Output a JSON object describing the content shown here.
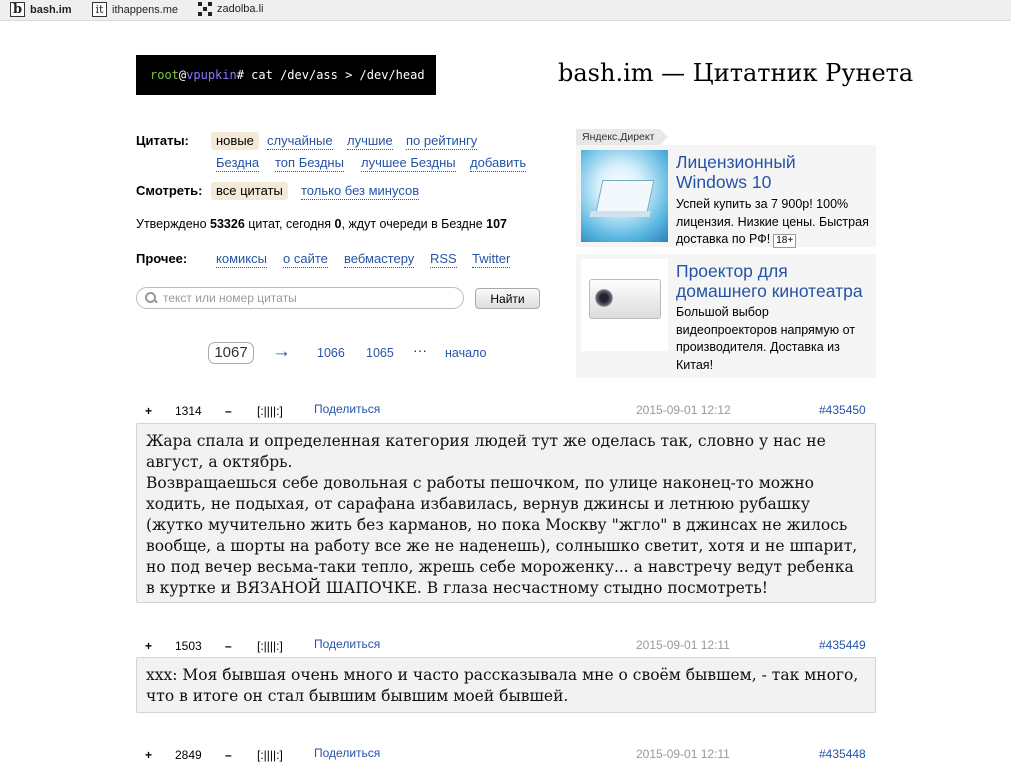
{
  "topbar": {
    "sites": [
      {
        "label": "bash.im",
        "icon": "b"
      },
      {
        "label": "ithappens.me",
        "icon": "it"
      },
      {
        "label": "zadolba.li",
        "icon": "zadolba-icon"
      }
    ]
  },
  "logo": {
    "root": "root",
    "at": "@",
    "host": "vpupkin",
    "cmd": "# cat /dev/ass > /dev/head"
  },
  "site_title": "bash.im — Цитатник Рунета",
  "nav": {
    "quotes_label": "Цитаты:",
    "quotes": [
      "новые",
      "случайные",
      "лучшие",
      "по рейтингу"
    ],
    "quotes_row2": [
      "Бездна",
      "топ Бездны",
      "лучшее Бездны",
      "добавить"
    ],
    "view_label": "Смотреть:",
    "view": [
      "все цитаты",
      "только без минусов"
    ],
    "other_label": "Прочее:",
    "other": [
      "комиксы",
      "о сайте",
      "вебмастеру",
      "RSS",
      "Twitter"
    ]
  },
  "stats": {
    "prefix": "Утверждено ",
    "approved": "53326",
    "mid1": " цитат, сегодня ",
    "today": "0",
    "mid2": ", ждут очереди в Бездне ",
    "queue": "107"
  },
  "search": {
    "placeholder": "текст или номер цитаты",
    "button": "Найти"
  },
  "pager": {
    "current": "1067",
    "arrow": "→",
    "pages": [
      "1066",
      "1065"
    ],
    "dots": "···",
    "start": "начало"
  },
  "ads": {
    "tag": "Яндекс.Директ",
    "items": [
      {
        "title_line1": "Лицензионный",
        "title_line2": "Windows 10",
        "text": "Успей купить за 7 900р! 100% лицензия. Низкие цены. Быстрая доставка по РФ!",
        "age": "18+"
      },
      {
        "title_line1": "Проектор для",
        "title_line2": "домашнего кинотеатра",
        "text": "Большой выбор видеопроекторов напрямую от производителя. Доставка из Китая!"
      }
    ]
  },
  "quotes": [
    {
      "plus": "+",
      "rating": "1314",
      "minus": "–",
      "bayan": "[:||||:]",
      "share": "Поделиться",
      "date": "2015-09-01 12:12",
      "id": "#435450",
      "lines": [
        "Жара спала и определенная категория людей тут же оделась так, словно у нас не август, а октябрь.",
        "Возвращаешься себе довольная с работы пешочком, по улице наконец-то можно ходить, не подыхая, от сарафана избавилась, вернув джинсы и летнюю рубашку (жутко мучительно жить без карманов, но пока Москву \"жгло\" в джинсах не жилось вообще, а шорты на работу все же не наденешь), солнышко светит, хотя и не шпарит, но под вечер весьма-таки тепло, жрешь себе мороженку... а навстречу ведут ребенка в куртке и ВЯЗАНОЙ ШАПОЧКЕ. В глаза несчастному стыдно посмотреть!"
      ]
    },
    {
      "plus": "+",
      "rating": "1503",
      "minus": "–",
      "bayan": "[:||||:]",
      "share": "Поделиться",
      "date": "2015-09-01 12:11",
      "id": "#435449",
      "lines": [
        "xxx: Моя бывшая очень много и часто рассказывала мне о своём бывшем, - так много, что в итоге он стал бывшим бывшим моей бывшей."
      ]
    },
    {
      "plus": "+",
      "rating": "2849",
      "minus": "–",
      "bayan": "[:||||:]",
      "share": "Поделиться",
      "date": "2015-09-01 12:11",
      "id": "#435448"
    }
  ]
}
